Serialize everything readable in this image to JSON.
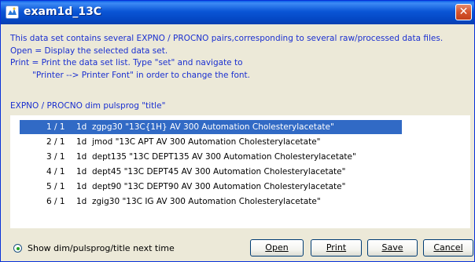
{
  "window": {
    "title": "exam1d_13C",
    "close_glyph": "✕"
  },
  "info": {
    "lines": [
      "This data set contains several EXPNO / PROCNO pairs,corresponding to several raw/processed data files.",
      "Open = Display the selected data set.",
      "Print = Print the data set list. Type \"set\" and navigate to",
      "\"Printer --> Printer Font\" in order to change the font."
    ]
  },
  "list": {
    "header": "EXPNO / PROCNO   dim pulsprog \"title\"",
    "rows": [
      {
        "expno": "1 / 1",
        "dim": "1d",
        "rest": "zgpg30  \"13C{1H}   AV 300 Automation   Cholesterylacetate\"",
        "selected": true
      },
      {
        "expno": "2 / 1",
        "dim": "1d",
        "rest": "jmod  \"13C APT    AV 300 Automation   Cholesterylacetate\"",
        "selected": false
      },
      {
        "expno": "3 / 1",
        "dim": "1d",
        "rest": "dept135  \"13C DEPT135   AV 300 Automation   Cholesterylacetate\"",
        "selected": false
      },
      {
        "expno": "4 / 1",
        "dim": "1d",
        "rest": "dept45  \"13C DEPT45    AV 300 Automation   Cholesterylacetate\"",
        "selected": false
      },
      {
        "expno": "5 / 1",
        "dim": "1d",
        "rest": "dept90  \"13C DEPT90    AV 300 Automation   Cholesterylacetate\"",
        "selected": false
      },
      {
        "expno": "6 / 1",
        "dim": "1d",
        "rest": "zgig30  \"13C IG    AV 300 Automation   Cholesterylacetate\"",
        "selected": false
      }
    ]
  },
  "footer": {
    "show_option_label": "Show dim/pulsprog/title next time",
    "show_option_checked": true,
    "buttons": {
      "open": "Open",
      "print": "Print",
      "save": "Save",
      "cancel": "Cancel"
    }
  },
  "colors": {
    "info_text": "#1a2fd0",
    "selection": "#316ac5",
    "titlebar": "#0a55d6",
    "close_button": "#d5542d"
  }
}
